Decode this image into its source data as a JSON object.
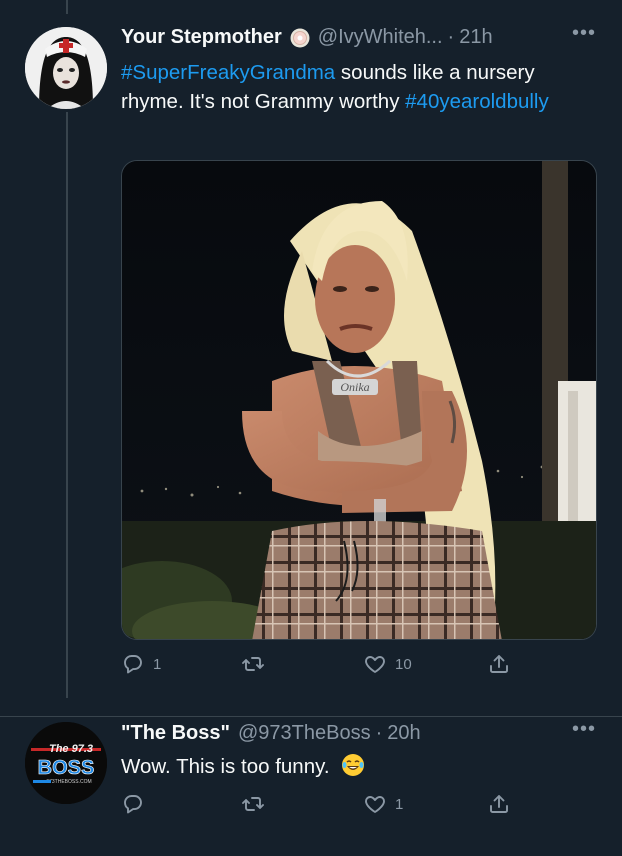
{
  "tweets": [
    {
      "author": {
        "display_name": "Your Stepmother",
        "handle": "@IvyWhiteh...",
        "separator": "·",
        "time": "21h"
      },
      "more": "•••",
      "text": {
        "hashtag1": "#SuperFreakyGrandma",
        "body": " sounds like a nursery rhyme. It's not Grammy worthy ",
        "hashtag2": "#40yearoldbully"
      },
      "media_text": "Onika",
      "actions": {
        "reply_count": "1",
        "retweet_count": "",
        "like_count": "10"
      }
    },
    {
      "author": {
        "display_name": "\"The Boss\"",
        "handle": "@973TheBoss",
        "separator": "·",
        "time": "20h"
      },
      "more": "•••",
      "text": {
        "body": "Wow. This is too funny."
      },
      "avatar_text": {
        "line1": "The 97.3",
        "line2": "BOSS",
        "line3": "973THEBOSS.COM"
      },
      "actions": {
        "reply_count": "",
        "retweet_count": "",
        "like_count": "1"
      }
    }
  ],
  "colors": {
    "background": "#15202b",
    "text": "#f7f9f9",
    "muted": "#8b98a5",
    "link": "#1d9bf0",
    "border": "#38444d"
  },
  "icons": [
    "reply-icon",
    "retweet-icon",
    "like-icon",
    "share-icon",
    "more-icon",
    "laughing-emoji-icon",
    "badge-icon"
  ]
}
